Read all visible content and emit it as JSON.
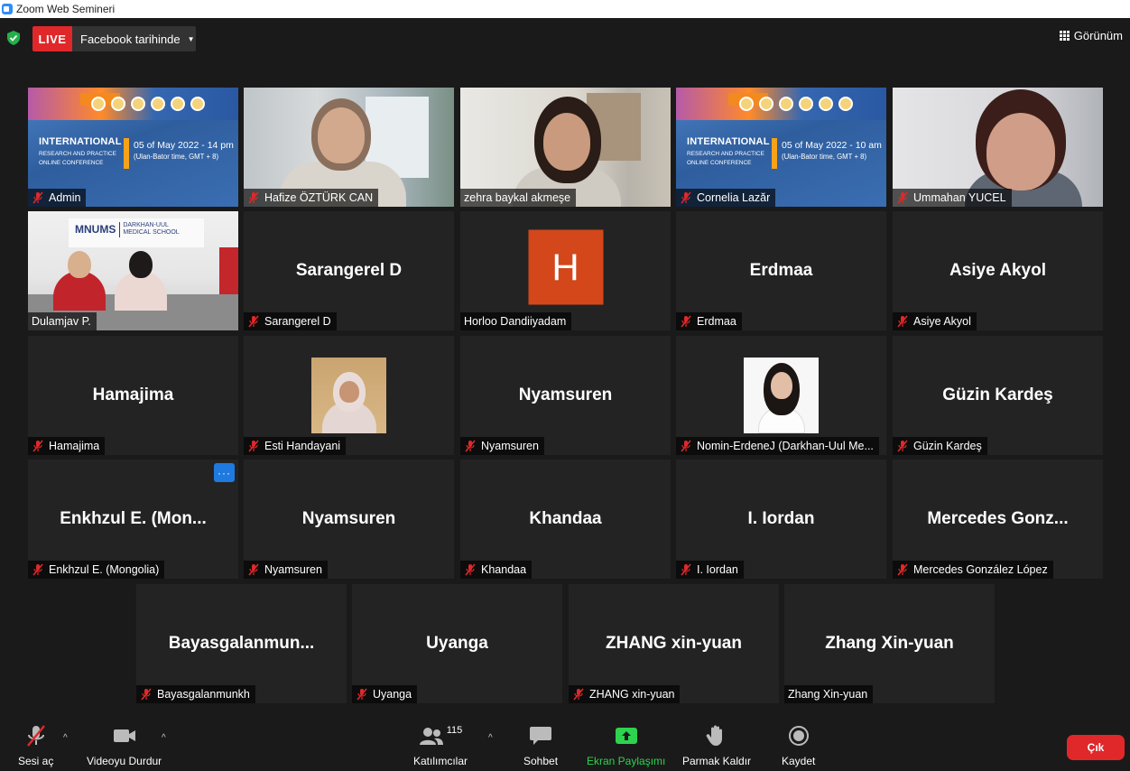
{
  "window": {
    "title": "Zoom Web Semineri"
  },
  "topbar": {
    "live_label": "LIVE",
    "live_destination": "Facebook tarihinde",
    "view_label": "Görünüm"
  },
  "poster": {
    "title": "INTERNATIONAL",
    "subtitle1": "RESEARCH AND PRACTICE",
    "subtitle2": "ONLINE CONFERENCE"
  },
  "tiles": [
    {
      "name": "Admin",
      "muted": true,
      "kind": "poster",
      "date": "05 of May 2022 - 14 pm",
      "tz": "(Ulan-Bator time, GMT + 8)"
    },
    {
      "name": "Hafize ÖZTÜRK CAN",
      "muted": true,
      "kind": "video",
      "scene": "hafize"
    },
    {
      "name": "zehra baykal akmeşe",
      "muted": false,
      "kind": "video",
      "scene": "zehra",
      "speaking": true
    },
    {
      "name": "Cornelia Lazăr",
      "muted": true,
      "kind": "poster",
      "date": "05 of May 2022 - 10 am",
      "tz": "(Ulan-Bator time, GMT + 8)"
    },
    {
      "name": "Ummahan YUCEL",
      "muted": true,
      "kind": "video",
      "scene": "ummahan"
    },
    {
      "name": "Dulamjav P.",
      "muted": false,
      "kind": "video",
      "scene": "dulam",
      "sign_main": "MNUMS",
      "sign_sub1": "DARKHAN-UUL",
      "sign_sub2": "MEDICAL SCHOOL"
    },
    {
      "name": "Sarangerel D",
      "muted": true,
      "kind": "name",
      "display": "Sarangerel D"
    },
    {
      "name": "Horloo Dandiiyadam",
      "muted": false,
      "kind": "avatar",
      "initial": "H"
    },
    {
      "name": "Erdmaa",
      "muted": true,
      "kind": "name",
      "display": "Erdmaa"
    },
    {
      "name": "Asiye Akyol",
      "muted": true,
      "kind": "name",
      "display": "Asiye Akyol"
    },
    {
      "name": "Hamajima",
      "muted": true,
      "kind": "name",
      "display": "Hamajima"
    },
    {
      "name": "Esti Handayani",
      "muted": true,
      "kind": "photo",
      "scene": "esti"
    },
    {
      "name": "Nyamsuren",
      "muted": true,
      "kind": "name",
      "display": "Nyamsuren"
    },
    {
      "name": "Nomin-ErdeneJ (Darkhan-Uul Me...",
      "muted": true,
      "kind": "photo",
      "scene": "nomin"
    },
    {
      "name": "Güzin Kardeş",
      "muted": true,
      "kind": "name",
      "display": "Güzin Kardeş"
    },
    {
      "name": "Enkhzul E. (Mongolia)",
      "muted": true,
      "kind": "name",
      "display": "Enkhzul E. (Mon...",
      "more": "···"
    },
    {
      "name": "Nyamsuren",
      "muted": true,
      "kind": "name",
      "display": "Nyamsuren"
    },
    {
      "name": "Khandaa",
      "muted": true,
      "kind": "name",
      "display": "Khandaa"
    },
    {
      "name": "I. Iordan",
      "muted": true,
      "kind": "name",
      "display": "I. Iordan"
    },
    {
      "name": "Mercedes González López",
      "muted": true,
      "kind": "name",
      "display": "Mercedes Gonz..."
    },
    {
      "name": "Bayasgalanmunkh",
      "muted": true,
      "kind": "name",
      "display": "Bayasgalanmun..."
    },
    {
      "name": "Uyanga",
      "muted": true,
      "kind": "name",
      "display": "Uyanga"
    },
    {
      "name": "ZHANG xin-yuan",
      "muted": true,
      "kind": "name",
      "display": "ZHANG xin-yuan"
    },
    {
      "name": "Zhang Xin-yuan",
      "muted": false,
      "kind": "name",
      "display": "Zhang Xin-yuan"
    }
  ],
  "toolbar": {
    "unmute_label": "Sesi aç",
    "stop_video_label": "Videoyu Durdur",
    "participants_label": "Katılımcılar",
    "participants_count": "115",
    "chat_label": "Sohbet",
    "share_label": "Ekran Paylaşımı",
    "raise_hand_label": "Parmak Kaldır",
    "record_label": "Kaydet",
    "leave_label": "Çık"
  },
  "colors": {
    "live_red": "#e0282a",
    "active_speaker": "#e8f04a",
    "share_green": "#2dd34f",
    "avatar_orange": "#d3471a"
  }
}
